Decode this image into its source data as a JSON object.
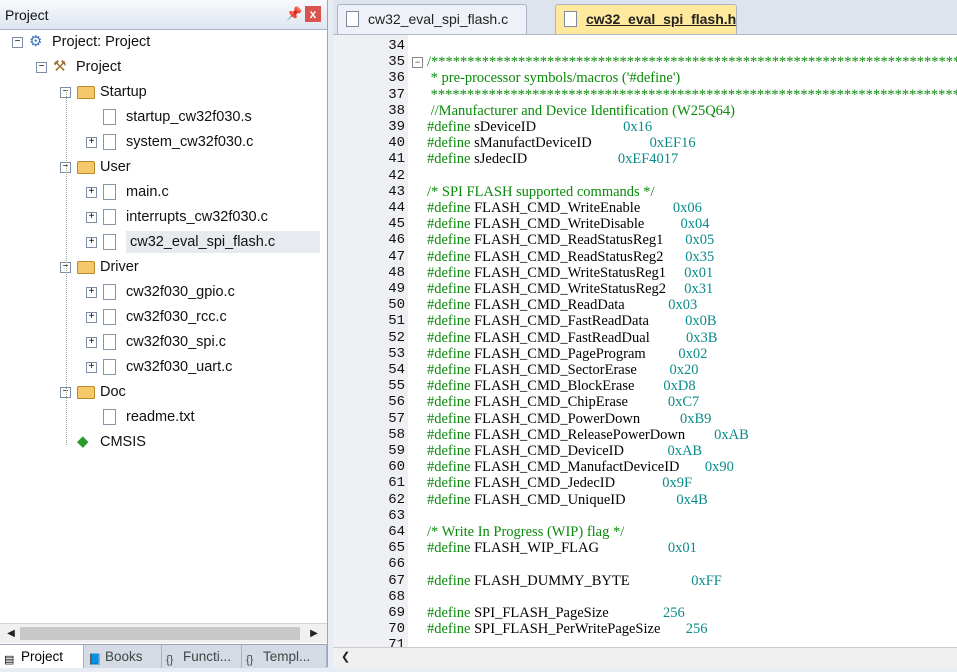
{
  "project_panel": {
    "title": "Project",
    "pin_icon": "pin-icon",
    "close_label": "x",
    "tree": [
      {
        "label": "Project: Project",
        "level": 0,
        "kind": "root",
        "expander": "−"
      },
      {
        "label": "Project",
        "level": 1,
        "kind": "target",
        "expander": "−"
      },
      {
        "label": "Startup",
        "level": 2,
        "kind": "folder",
        "expander": "−"
      },
      {
        "label": "startup_cw32f030.s",
        "level": 3,
        "kind": "file",
        "expander": ""
      },
      {
        "label": "system_cw32f030.c",
        "level": 3,
        "kind": "file",
        "expander": "+"
      },
      {
        "label": "User",
        "level": 2,
        "kind": "folder",
        "expander": "−"
      },
      {
        "label": "main.c",
        "level": 3,
        "kind": "file",
        "expander": "+"
      },
      {
        "label": "interrupts_cw32f030.c",
        "level": 3,
        "kind": "file",
        "expander": "+"
      },
      {
        "label": "cw32_eval_spi_flash.c",
        "level": 3,
        "kind": "file",
        "expander": "+",
        "selected": true
      },
      {
        "label": "Driver",
        "level": 2,
        "kind": "folder",
        "expander": "−"
      },
      {
        "label": "cw32f030_gpio.c",
        "level": 3,
        "kind": "file",
        "expander": "+"
      },
      {
        "label": "cw32f030_rcc.c",
        "level": 3,
        "kind": "file",
        "expander": "+"
      },
      {
        "label": "cw32f030_spi.c",
        "level": 3,
        "kind": "file",
        "expander": "+"
      },
      {
        "label": "cw32f030_uart.c",
        "level": 3,
        "kind": "file",
        "expander": "+"
      },
      {
        "label": "Doc",
        "level": 2,
        "kind": "folder",
        "expander": "−"
      },
      {
        "label": "readme.txt",
        "level": 3,
        "kind": "file",
        "expander": ""
      },
      {
        "label": "CMSIS",
        "level": 2,
        "kind": "component",
        "expander": ""
      }
    ],
    "bottom_tabs": [
      {
        "label": "Project",
        "icon": "project-icon",
        "active": true
      },
      {
        "label": "Books",
        "icon": "books-icon",
        "active": false
      },
      {
        "label": "Functi...",
        "icon": "functions-icon",
        "active": false
      },
      {
        "label": "Templ...",
        "icon": "templates-icon",
        "active": false
      }
    ]
  },
  "editor": {
    "tabs": [
      {
        "label": "cw32_eval_spi_flash.c",
        "active": false
      },
      {
        "label": "cw32_eval_spi_flash.h",
        "active": true
      }
    ],
    "lines": [
      {
        "n": "34",
        "parts": [],
        "fold": ""
      },
      {
        "n": "35",
        "parts": [
          {
            "c": "cmt",
            "t": "/*************************************************************************"
          }
        ],
        "fold": "−"
      },
      {
        "n": "36",
        "parts": [
          {
            "c": "cmt",
            "t": " * pre-processor symbols/macros ('#define')"
          }
        ],
        "fold": ""
      },
      {
        "n": "37",
        "parts": [
          {
            "c": "cmt",
            "t": " *************************************************************************"
          }
        ],
        "fold": ""
      },
      {
        "n": "38",
        "parts": [
          {
            "c": "cmt",
            "t": " //Manufacturer and Device Identification (W25Q64)"
          }
        ],
        "fold": ""
      },
      {
        "n": "39",
        "parts": [
          {
            "c": "kw",
            "t": "#define"
          },
          {
            "c": "",
            "t": " sDeviceID                        "
          },
          {
            "c": "num",
            "t": "0x16"
          }
        ],
        "fold": ""
      },
      {
        "n": "40",
        "parts": [
          {
            "c": "kw",
            "t": "#define"
          },
          {
            "c": "",
            "t": " sManufactDeviceID                "
          },
          {
            "c": "num",
            "t": "0xEF16"
          }
        ],
        "fold": ""
      },
      {
        "n": "41",
        "parts": [
          {
            "c": "kw",
            "t": "#define"
          },
          {
            "c": "",
            "t": " sJedecID                         "
          },
          {
            "c": "num",
            "t": "0xEF4017"
          }
        ],
        "fold": ""
      },
      {
        "n": "42",
        "parts": [],
        "fold": ""
      },
      {
        "n": "43",
        "parts": [
          {
            "c": "cmt",
            "t": "/* SPI FLASH supported commands */"
          }
        ],
        "fold": ""
      },
      {
        "n": "44",
        "parts": [
          {
            "c": "kw",
            "t": "#define"
          },
          {
            "c": "",
            "t": " FLASH_CMD_WriteEnable         "
          },
          {
            "c": "num",
            "t": "0x06"
          }
        ],
        "fold": ""
      },
      {
        "n": "45",
        "parts": [
          {
            "c": "kw",
            "t": "#define"
          },
          {
            "c": "",
            "t": " FLASH_CMD_WriteDisable          "
          },
          {
            "c": "num",
            "t": "0x04"
          }
        ],
        "fold": ""
      },
      {
        "n": "46",
        "parts": [
          {
            "c": "kw",
            "t": "#define"
          },
          {
            "c": "",
            "t": " FLASH_CMD_ReadStatusReg1      "
          },
          {
            "c": "num",
            "t": "0x05"
          }
        ],
        "fold": ""
      },
      {
        "n": "47",
        "parts": [
          {
            "c": "kw",
            "t": "#define"
          },
          {
            "c": "",
            "t": " FLASH_CMD_ReadStatusReg2      "
          },
          {
            "c": "num",
            "t": "0x35"
          }
        ],
        "fold": ""
      },
      {
        "n": "48",
        "parts": [
          {
            "c": "kw",
            "t": "#define"
          },
          {
            "c": "",
            "t": " FLASH_CMD_WriteStatusReg1     "
          },
          {
            "c": "num",
            "t": "0x01"
          }
        ],
        "fold": ""
      },
      {
        "n": "49",
        "parts": [
          {
            "c": "kw",
            "t": "#define"
          },
          {
            "c": "",
            "t": " FLASH_CMD_WriteStatusReg2     "
          },
          {
            "c": "num",
            "t": "0x31"
          }
        ],
        "fold": ""
      },
      {
        "n": "50",
        "parts": [
          {
            "c": "kw",
            "t": "#define"
          },
          {
            "c": "",
            "t": " FLASH_CMD_ReadData            "
          },
          {
            "c": "num",
            "t": "0x03"
          }
        ],
        "fold": ""
      },
      {
        "n": "51",
        "parts": [
          {
            "c": "kw",
            "t": "#define"
          },
          {
            "c": "",
            "t": " FLASH_CMD_FastReadData          "
          },
          {
            "c": "num",
            "t": "0x0B"
          }
        ],
        "fold": ""
      },
      {
        "n": "52",
        "parts": [
          {
            "c": "kw",
            "t": "#define"
          },
          {
            "c": "",
            "t": " FLASH_CMD_FastReadDual          "
          },
          {
            "c": "num",
            "t": "0x3B"
          }
        ],
        "fold": ""
      },
      {
        "n": "53",
        "parts": [
          {
            "c": "kw",
            "t": "#define"
          },
          {
            "c": "",
            "t": " FLASH_CMD_PageProgram         "
          },
          {
            "c": "num",
            "t": "0x02"
          }
        ],
        "fold": ""
      },
      {
        "n": "54",
        "parts": [
          {
            "c": "kw",
            "t": "#define"
          },
          {
            "c": "",
            "t": " FLASH_CMD_SectorErase         "
          },
          {
            "c": "num",
            "t": "0x20"
          }
        ],
        "fold": ""
      },
      {
        "n": "55",
        "parts": [
          {
            "c": "kw",
            "t": "#define"
          },
          {
            "c": "",
            "t": " FLASH_CMD_BlockErase        "
          },
          {
            "c": "num",
            "t": "0xD8"
          }
        ],
        "fold": ""
      },
      {
        "n": "56",
        "parts": [
          {
            "c": "kw",
            "t": "#define"
          },
          {
            "c": "",
            "t": " FLASH_CMD_ChipErase           "
          },
          {
            "c": "num",
            "t": "0xC7"
          }
        ],
        "fold": ""
      },
      {
        "n": "57",
        "parts": [
          {
            "c": "kw",
            "t": "#define"
          },
          {
            "c": "",
            "t": " FLASH_CMD_PowerDown           "
          },
          {
            "c": "num",
            "t": "0xB9"
          }
        ],
        "fold": ""
      },
      {
        "n": "58",
        "parts": [
          {
            "c": "kw",
            "t": "#define"
          },
          {
            "c": "",
            "t": " FLASH_CMD_ReleasePowerDown        "
          },
          {
            "c": "num",
            "t": "0xAB"
          }
        ],
        "fold": ""
      },
      {
        "n": "59",
        "parts": [
          {
            "c": "kw",
            "t": "#define"
          },
          {
            "c": "",
            "t": " FLASH_CMD_DeviceID            "
          },
          {
            "c": "num",
            "t": "0xAB"
          }
        ],
        "fold": ""
      },
      {
        "n": "60",
        "parts": [
          {
            "c": "kw",
            "t": "#define"
          },
          {
            "c": "",
            "t": " FLASH_CMD_ManufactDeviceID       "
          },
          {
            "c": "num",
            "t": "0x90"
          }
        ],
        "fold": ""
      },
      {
        "n": "61",
        "parts": [
          {
            "c": "kw",
            "t": "#define"
          },
          {
            "c": "",
            "t": " FLASH_CMD_JedecID             "
          },
          {
            "c": "num",
            "t": "0x9F"
          }
        ],
        "fold": ""
      },
      {
        "n": "62",
        "parts": [
          {
            "c": "kw",
            "t": "#define"
          },
          {
            "c": "",
            "t": " FLASH_CMD_UniqueID              "
          },
          {
            "c": "num",
            "t": "0x4B"
          }
        ],
        "fold": ""
      },
      {
        "n": "63",
        "parts": [],
        "fold": ""
      },
      {
        "n": "64",
        "parts": [
          {
            "c": "cmt",
            "t": "/* Write In Progress (WIP) flag */"
          }
        ],
        "fold": ""
      },
      {
        "n": "65",
        "parts": [
          {
            "c": "kw",
            "t": "#define"
          },
          {
            "c": "",
            "t": " FLASH_WIP_FLAG                   "
          },
          {
            "c": "num",
            "t": "0x01"
          }
        ],
        "fold": ""
      },
      {
        "n": "66",
        "parts": [],
        "fold": ""
      },
      {
        "n": "67",
        "parts": [
          {
            "c": "kw",
            "t": "#define"
          },
          {
            "c": "",
            "t": " FLASH_DUMMY_BYTE                 "
          },
          {
            "c": "num",
            "t": "0xFF"
          }
        ],
        "fold": ""
      },
      {
        "n": "68",
        "parts": [],
        "fold": ""
      },
      {
        "n": "69",
        "parts": [
          {
            "c": "kw",
            "t": "#define"
          },
          {
            "c": "",
            "t": " SPI_FLASH_PageSize               "
          },
          {
            "c": "num",
            "t": "256"
          }
        ],
        "fold": ""
      },
      {
        "n": "70",
        "parts": [
          {
            "c": "kw",
            "t": "#define"
          },
          {
            "c": "",
            "t": " SPI_FLASH_PerWritePageSize       "
          },
          {
            "c": "num",
            "t": "256"
          }
        ],
        "fold": ""
      },
      {
        "n": "71",
        "parts": [],
        "fold": ""
      }
    ]
  },
  "colors": {
    "comment": "#0a8a0a",
    "number": "#0a8a8a",
    "active_tab": "#ffe99c"
  }
}
